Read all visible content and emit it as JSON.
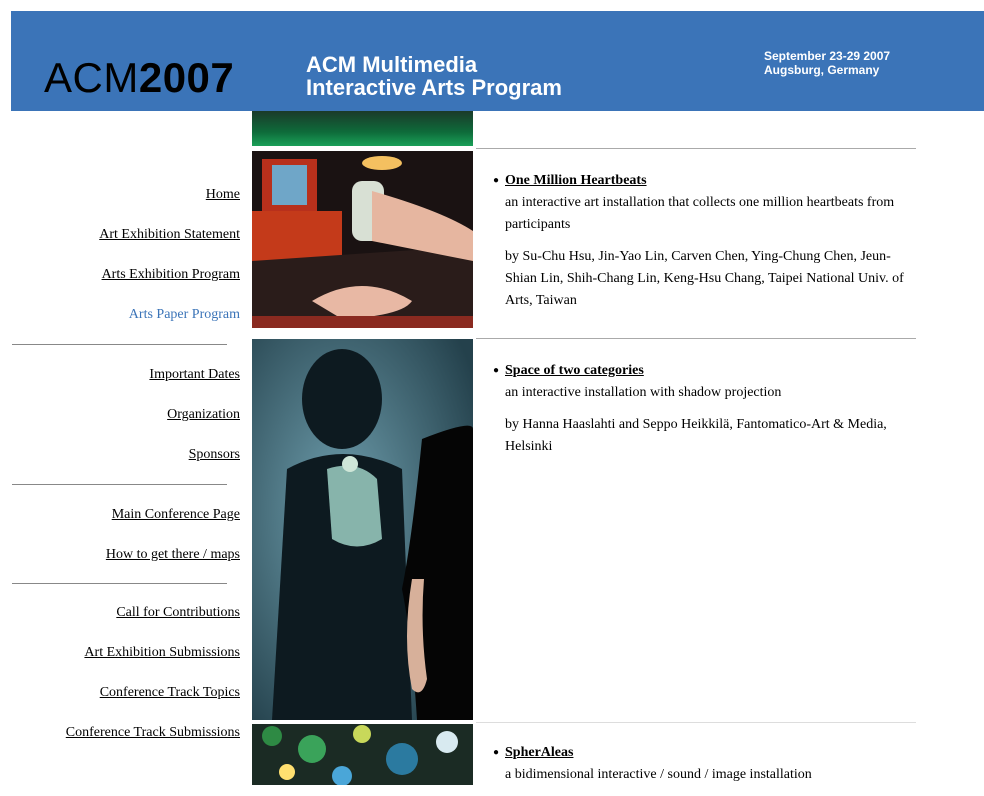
{
  "header": {
    "logo_prefix": "ACM",
    "logo_year": "2007",
    "title_line1": "ACM Multimedia",
    "title_line2": "Interactive Arts Program",
    "date_line1": "September 23-29 2007",
    "date_line2": "Augsburg, Germany",
    "bg_color": "#3b74b8"
  },
  "nav": {
    "group1": [
      "Home",
      "Art Exhibition Statement",
      "Arts Exhibition Program",
      "Arts Paper Program"
    ],
    "group2": [
      "Important Dates",
      "Organization",
      "Sponsors"
    ],
    "group3": [
      "Main Conference Page",
      "How to get there / maps"
    ],
    "group4": [
      "Call for Contributions",
      "Art Exhibition Submissions",
      "Conference Track Topics",
      "Conference Track Submissions"
    ],
    "active_color": "#3b74b8"
  },
  "entries": [
    {
      "title": "One Million Heartbeats",
      "description": "an interactive art installation that collects one million heartbeats from participants",
      "credits": "by Su-Chu Hsu, Jin-Yao Lin, Carven Chen, Ying-Chung Chen, Jeun-Shian Lin, Shih-Chang Lin, Keng-Hsu Chang, Taipei National Univ. of Arts, Taiwan"
    },
    {
      "title": "Space of two categories",
      "description": "an interactive installation with shadow projection",
      "credits": "by Hanna Haaslahti and Seppo Heikkilä, Fantomatico-Art & Media, Helsinki"
    },
    {
      "title": "SpherAleas",
      "description": "a bidimensional interactive / sound / image installation"
    }
  ]
}
